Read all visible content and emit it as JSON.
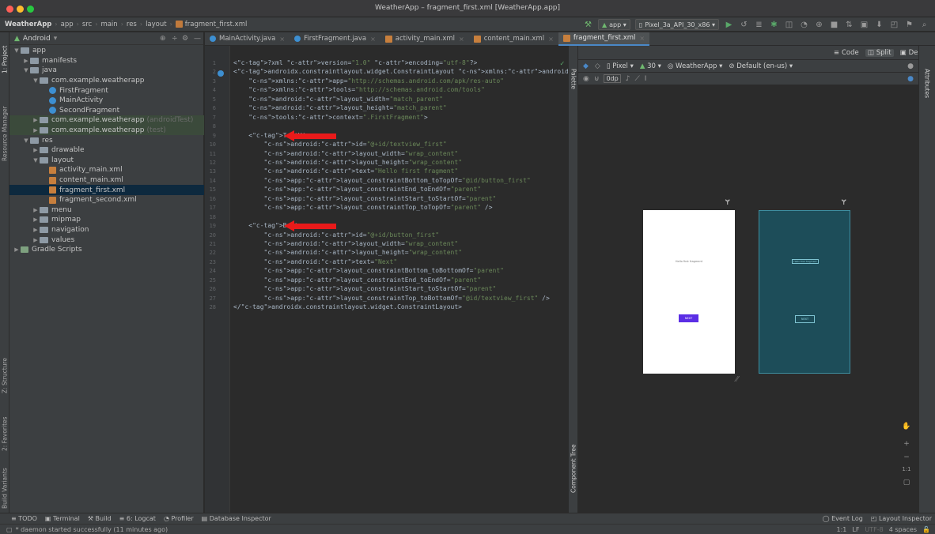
{
  "window_title": "WeatherApp – fragment_first.xml [WeatherApp.app]",
  "breadcrumbs": [
    "WeatherApp",
    "app",
    "src",
    "main",
    "res",
    "layout",
    "fragment_first.xml"
  ],
  "toolbar": {
    "run_config": "app",
    "device": "Pixel_3a_API_30_x86"
  },
  "project_panel": {
    "view_mode": "Android",
    "items": [
      {
        "label": "app",
        "level": 0,
        "expanded": true,
        "type": "module"
      },
      {
        "label": "manifests",
        "level": 1,
        "expanded": false,
        "type": "folder"
      },
      {
        "label": "java",
        "level": 1,
        "expanded": true,
        "type": "folder"
      },
      {
        "label": "com.example.weatherapp",
        "level": 2,
        "expanded": true,
        "type": "folder"
      },
      {
        "label": "FirstFragment",
        "level": 3,
        "type": "class"
      },
      {
        "label": "MainActivity",
        "level": 3,
        "type": "class"
      },
      {
        "label": "SecondFragment",
        "level": 3,
        "type": "class"
      },
      {
        "label": "com.example.weatherapp",
        "suffix": "(androidTest)",
        "level": 2,
        "expanded": false,
        "type": "folder",
        "test": true
      },
      {
        "label": "com.example.weatherapp",
        "suffix": "(test)",
        "level": 2,
        "expanded": false,
        "type": "folder",
        "test": true
      },
      {
        "label": "res",
        "level": 1,
        "expanded": true,
        "type": "folder"
      },
      {
        "label": "drawable",
        "level": 2,
        "expanded": false,
        "type": "folder"
      },
      {
        "label": "layout",
        "level": 2,
        "expanded": true,
        "type": "folder"
      },
      {
        "label": "activity_main.xml",
        "level": 3,
        "type": "xml"
      },
      {
        "label": "content_main.xml",
        "level": 3,
        "type": "xml"
      },
      {
        "label": "fragment_first.xml",
        "level": 3,
        "type": "xml",
        "selected": true
      },
      {
        "label": "fragment_second.xml",
        "level": 3,
        "type": "xml"
      },
      {
        "label": "menu",
        "level": 2,
        "expanded": false,
        "type": "folder"
      },
      {
        "label": "mipmap",
        "level": 2,
        "expanded": false,
        "type": "folder"
      },
      {
        "label": "navigation",
        "level": 2,
        "expanded": false,
        "type": "folder"
      },
      {
        "label": "values",
        "level": 2,
        "expanded": false,
        "type": "folder"
      },
      {
        "label": "Gradle Scripts",
        "level": 0,
        "expanded": false,
        "type": "gradle"
      }
    ]
  },
  "left_tool_tabs": [
    "1: Project",
    "Resource Manager",
    "Z: Structure",
    "2: Favorites",
    "Build Variants"
  ],
  "editor_tabs": [
    {
      "label": "MainActivity.java",
      "type": "java"
    },
    {
      "label": "FirstFragment.java",
      "type": "java"
    },
    {
      "label": "activity_main.xml",
      "type": "xml"
    },
    {
      "label": "content_main.xml",
      "type": "xml"
    },
    {
      "label": "fragment_first.xml",
      "type": "xml",
      "active": true
    }
  ],
  "code_lines": [
    "<?xml version=\"1.0\" encoding=\"utf-8\"?>",
    "<androidx.constraintlayout.widget.ConstraintLayout xmlns:android=\"http://schemas.android.com/apk",
    "    xmlns:app=\"http://schemas.android.com/apk/res-auto\"",
    "    xmlns:tools=\"http://schemas.android.com/tools\"",
    "    android:layout_width=\"match_parent\"",
    "    android:layout_height=\"match_parent\"",
    "    tools:context=\".FirstFragment\">",
    "",
    "    <TextView",
    "        android:id=\"@+id/textview_first\"",
    "        android:layout_width=\"wrap_content\"",
    "        android:layout_height=\"wrap_content\"",
    "        android:text=\"Hello first fragment\"",
    "        app:layout_constraintBottom_toTopOf=\"@id/button_first\"",
    "        app:layout_constraintEnd_toEndOf=\"parent\"",
    "        app:layout_constraintStart_toStartOf=\"parent\"",
    "        app:layout_constraintTop_toTopOf=\"parent\" />",
    "",
    "    <Button",
    "        android:id=\"@+id/button_first\"",
    "        android:layout_width=\"wrap_content\"",
    "        android:layout_height=\"wrap_content\"",
    "        android:text=\"Next\"",
    "        app:layout_constraintBottom_toBottomOf=\"parent\"",
    "        app:layout_constraintEnd_toEndOf=\"parent\"",
    "        app:layout_constraintStart_toStartOf=\"parent\"",
    "        app:layout_constraintTop_toBottomOf=\"@id/textview_first\" />",
    "</androidx.constraintlayout.widget.ConstraintLayout>"
  ],
  "design_view": {
    "mode_buttons": [
      "Code",
      "Split",
      "Design"
    ],
    "active_mode": "Split",
    "device": "Pixel",
    "api_level": "30",
    "theme": "WeatherApp",
    "locale": "Default (en-us)",
    "margin": "0dp",
    "preview_text": "Hello first fragment",
    "preview_button": "NEXT",
    "palette_label": "Palette",
    "component_tree_label": "Component Tree",
    "attributes_label": "Attributes",
    "zoom_label": "1:1"
  },
  "bottom_tools": [
    "TODO",
    "Terminal",
    "Build",
    "6: Logcat",
    "Profiler",
    "Database Inspector"
  ],
  "bottom_right_tools": [
    "Event Log",
    "Layout Inspector"
  ],
  "status": {
    "message": "* daemon started successfully (11 minutes ago)",
    "position": "1:1",
    "line_sep": "LF",
    "encoding": "UTF-8",
    "indent": "4 spaces"
  },
  "colors": {
    "accent": "#4a88c7",
    "arrow": "#e81a1a",
    "button_preview": "#5b2ee5",
    "blueprint": "#1d4d59"
  }
}
